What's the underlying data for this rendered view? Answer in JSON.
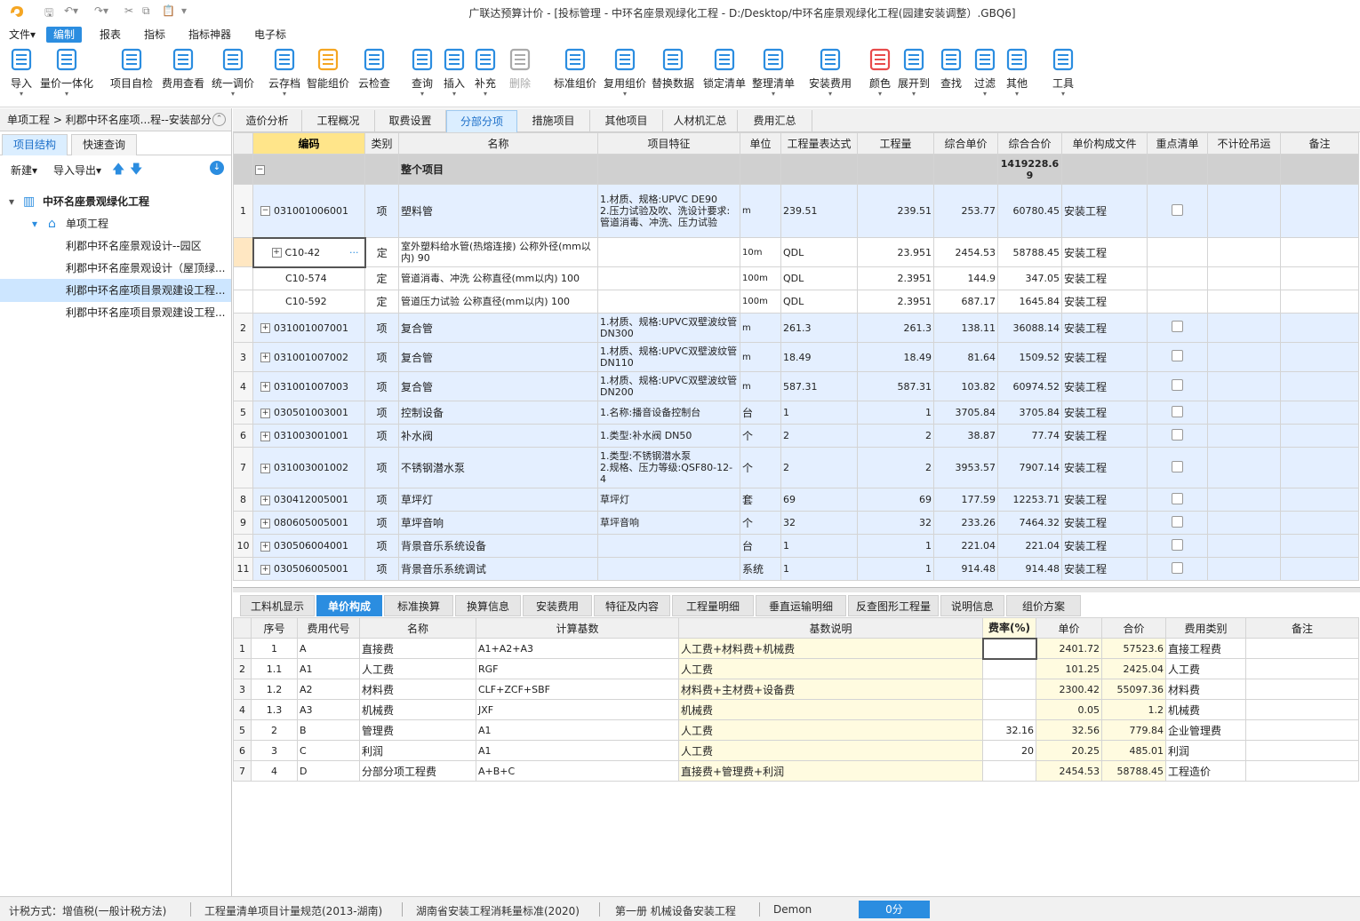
{
  "window": {
    "title": "广联达预算计价 - [投标管理 - 中环名座景观绿化工程 - D:/Desktop/中环名座景观绿化工程(园建安装调整）.GBQ6]"
  },
  "menu": [
    "文件▾",
    "编制",
    "报表",
    "指标",
    "指标神器",
    "电子标"
  ],
  "ribbon": [
    {
      "label": "导入",
      "icon": "import-icon",
      "color": "#2b8de0",
      "drop": "▾"
    },
    {
      "label": "量价一体化",
      "icon": "quantity-price-icon",
      "color": "#2b8de0",
      "drop": "▾"
    },
    {
      "label": "项目自检",
      "icon": "self-check-icon",
      "color": "#2b8de0",
      "drop": ""
    },
    {
      "label": "费用查看",
      "icon": "fee-view-icon",
      "color": "#2b8de0",
      "drop": ""
    },
    {
      "label": "统一调价",
      "icon": "unify-price-icon",
      "color": "#2b8de0",
      "drop": "▾"
    },
    {
      "label": "云存档",
      "icon": "cloud-archive-icon",
      "color": "#2b8de0",
      "drop": "▾"
    },
    {
      "label": "智能组价",
      "icon": "smart-price-icon",
      "color": "#f5a623",
      "drop": ""
    },
    {
      "label": "云检查",
      "icon": "cloud-check-icon",
      "color": "#2b8de0",
      "drop": ""
    },
    {
      "label": "查询",
      "icon": "query-icon",
      "color": "#2b8de0",
      "drop": "▾"
    },
    {
      "label": "插入",
      "icon": "insert-icon",
      "color": "#2b8de0",
      "drop": "▾"
    },
    {
      "label": "补充",
      "icon": "supplement-icon",
      "color": "#2b8de0",
      "drop": "▾"
    },
    {
      "label": "删除",
      "icon": "delete-icon",
      "color": "#aaaaaa",
      "drop": ""
    },
    {
      "label": "标准组价",
      "icon": "standard-price-icon",
      "color": "#2b8de0",
      "drop": ""
    },
    {
      "label": "复用组价",
      "icon": "reuse-price-icon",
      "color": "#2b8de0",
      "drop": "▾"
    },
    {
      "label": "替换数据",
      "icon": "replace-data-icon",
      "color": "#2b8de0",
      "drop": ""
    },
    {
      "label": "锁定清单",
      "icon": "lock-list-icon",
      "color": "#2b8de0",
      "drop": ""
    },
    {
      "label": "整理清单",
      "icon": "organize-list-icon",
      "color": "#2b8de0",
      "drop": "▾"
    },
    {
      "label": "安装费用",
      "icon": "install-fee-icon",
      "color": "#2b8de0",
      "drop": "▾"
    },
    {
      "label": "颜色",
      "icon": "color-icon",
      "color": "#e84b4b",
      "drop": "▾"
    },
    {
      "label": "展开到",
      "icon": "expand-to-icon",
      "color": "#2b8de0",
      "drop": "▾"
    },
    {
      "label": "查找",
      "icon": "find-icon",
      "color": "#2b8de0",
      "drop": ""
    },
    {
      "label": "过滤",
      "icon": "filter-icon",
      "color": "#2b8de0",
      "drop": "▾"
    },
    {
      "label": "其他",
      "icon": "other-icon",
      "color": "#2b8de0",
      "drop": "▾"
    },
    {
      "label": "工具",
      "icon": "tools-icon",
      "color": "#2b8de0",
      "drop": "▾"
    }
  ],
  "left": {
    "breadcrumb": "单项工程 > 利郡中环名座项...程--安装部分",
    "tabs": [
      "项目结构",
      "快速查询"
    ],
    "tools": {
      "new": "新建▾",
      "import_export": "导入导出▾"
    },
    "tree": [
      {
        "label": "中环名座景观绿化工程",
        "level": 0,
        "bold": true
      },
      {
        "label": "单项工程",
        "level": 1,
        "bold": false
      },
      {
        "label": "利郡中环名座景观设计--园区",
        "level": 2,
        "bold": false
      },
      {
        "label": "利郡中环名座景观设计（屋顶绿...",
        "level": 2,
        "bold": false
      },
      {
        "label": "利郡中环名座项目景观建设工程...",
        "level": 2,
        "bold": false,
        "selected": true
      },
      {
        "label": "利郡中环名座项目景观建设工程...",
        "level": 2,
        "bold": false
      }
    ]
  },
  "tabs_top": [
    "造价分析",
    "工程概况",
    "取费设置",
    "分部分项",
    "措施项目",
    "其他项目",
    "人材机汇总",
    "费用汇总"
  ],
  "grid": {
    "headers": [
      "编码",
      "类别",
      "名称",
      "项目特征",
      "单位",
      "工程量表达式",
      "工程量",
      "综合单价",
      "综合合价",
      "单价构成文件",
      "重点清单",
      "不计砼吊运",
      "备注"
    ],
    "total": {
      "label": "整个项目",
      "amount": "1419228.69"
    },
    "rows": [
      {
        "no": "1",
        "code": "031001006001",
        "type": "项",
        "name": "塑料管",
        "feature": "1.材质、规格:UPVC DE90\n2.压力试验及吹、洗设计要求:管道消毒、冲洗、压力试验",
        "unit": "m",
        "expr": "239.51",
        "qty": "239.51",
        "price": "253.77",
        "total": "60780.45",
        "file": "安装工程",
        "kind": "q",
        "exp": "−",
        "h": 60
      },
      {
        "no": "",
        "code": "C10-42",
        "type": "定",
        "name": "室外塑料给水管(热熔连接) 公称外径(mm以内) 90",
        "feature": "",
        "unit": "10m",
        "expr": "QDL",
        "qty": "23.951",
        "price": "2454.53",
        "total": "58788.45",
        "file": "安装工程",
        "kind": "sub",
        "exp": "+",
        "h": 33
      },
      {
        "no": "",
        "code": "C10-574",
        "type": "定",
        "name": "管道消毒、冲洗 公称直径(mm以内) 100",
        "feature": "",
        "unit": "100m",
        "expr": "QDL",
        "qty": "2.3951",
        "price": "144.9",
        "total": "347.05",
        "file": "安装工程",
        "kind": "sub",
        "exp": "",
        "h": 26
      },
      {
        "no": "",
        "code": "C10-592",
        "type": "定",
        "name": "管道压力试验 公称直径(mm以内) 100",
        "feature": "",
        "unit": "100m",
        "expr": "QDL",
        "qty": "2.3951",
        "price": "687.17",
        "total": "1645.84",
        "file": "安装工程",
        "kind": "sub",
        "exp": "",
        "h": 26
      },
      {
        "no": "2",
        "code": "031001007001",
        "type": "项",
        "name": "复合管",
        "feature": "1.材质、规格:UPVC双壁波纹管 DN300",
        "unit": "m",
        "expr": "261.3",
        "qty": "261.3",
        "price": "138.11",
        "total": "36088.14",
        "file": "安装工程",
        "kind": "q",
        "exp": "+",
        "h": 33
      },
      {
        "no": "3",
        "code": "031001007002",
        "type": "项",
        "name": "复合管",
        "feature": "1.材质、规格:UPVC双壁波纹管 DN110",
        "unit": "m",
        "expr": "18.49",
        "qty": "18.49",
        "price": "81.64",
        "total": "1509.52",
        "file": "安装工程",
        "kind": "q",
        "exp": "+",
        "h": 33
      },
      {
        "no": "4",
        "code": "031001007003",
        "type": "项",
        "name": "复合管",
        "feature": "1.材质、规格:UPVC双壁波纹管 DN200",
        "unit": "m",
        "expr": "587.31",
        "qty": "587.31",
        "price": "103.82",
        "total": "60974.52",
        "file": "安装工程",
        "kind": "q",
        "exp": "+",
        "h": 33
      },
      {
        "no": "5",
        "code": "030501003001",
        "type": "项",
        "name": "控制设备",
        "feature": "1.名称:播音设备控制台",
        "unit": "台",
        "expr": "1",
        "qty": "1",
        "price": "3705.84",
        "total": "3705.84",
        "file": "安装工程",
        "kind": "q",
        "exp": "+",
        "h": 26
      },
      {
        "no": "6",
        "code": "031003001001",
        "type": "项",
        "name": "补水阀",
        "feature": "1.类型:补水阀 DN50",
        "unit": "个",
        "expr": "2",
        "qty": "2",
        "price": "38.87",
        "total": "77.74",
        "file": "安装工程",
        "kind": "q",
        "exp": "+",
        "h": 26
      },
      {
        "no": "7",
        "code": "031003001002",
        "type": "项",
        "name": "不锈钢潜水泵",
        "feature": "1.类型:不锈钢潜水泵\n2.规格、压力等级:QSF80-12-4",
        "unit": "个",
        "expr": "2",
        "qty": "2",
        "price": "3953.57",
        "total": "7907.14",
        "file": "安装工程",
        "kind": "q",
        "exp": "+",
        "h": 46
      },
      {
        "no": "8",
        "code": "030412005001",
        "type": "项",
        "name": "草坪灯",
        "feature": "草坪灯",
        "unit": "套",
        "expr": "69",
        "qty": "69",
        "price": "177.59",
        "total": "12253.71",
        "file": "安装工程",
        "kind": "q",
        "exp": "+",
        "h": 26
      },
      {
        "no": "9",
        "code": "080605005001",
        "type": "项",
        "name": "草坪音响",
        "feature": "草坪音响",
        "unit": "个",
        "expr": "32",
        "qty": "32",
        "price": "233.26",
        "total": "7464.32",
        "file": "安装工程",
        "kind": "q",
        "exp": "+",
        "h": 26
      },
      {
        "no": "10",
        "code": "030506004001",
        "type": "项",
        "name": "背景音乐系统设备",
        "feature": "",
        "unit": "台",
        "expr": "1",
        "qty": "1",
        "price": "221.04",
        "total": "221.04",
        "file": "安装工程",
        "kind": "q",
        "exp": "+",
        "h": 26
      },
      {
        "no": "11",
        "code": "030506005001",
        "type": "项",
        "name": "背景音乐系统调试",
        "feature": "",
        "unit": "系统",
        "expr": "1",
        "qty": "1",
        "price": "914.48",
        "total": "914.48",
        "file": "安装工程",
        "kind": "q",
        "exp": "+",
        "h": 26
      }
    ]
  },
  "tabs_bottom": [
    "工料机显示",
    "单价构成",
    "标准换算",
    "换算信息",
    "安装费用",
    "特征及内容",
    "工程量明细",
    "垂直运输明细",
    "反查图形工程量",
    "说明信息",
    "组价方案"
  ],
  "cost": {
    "headers": [
      "序号",
      "费用代号",
      "名称",
      "计算基数",
      "基数说明",
      "费率(%)",
      "单价",
      "合价",
      "费用类别",
      "备注"
    ],
    "rows": [
      {
        "no": "1",
        "seq": "1",
        "code": "A",
        "name": "直接费",
        "base": "A1+A2+A3",
        "desc": "人工费+材料费+机械费",
        "rate": "",
        "price": "2401.72",
        "total": "57523.6",
        "cat": "直接工程费"
      },
      {
        "no": "2",
        "seq": "1.1",
        "code": "A1",
        "name": "人工费",
        "base": "RGF",
        "desc": "人工费",
        "rate": "",
        "price": "101.25",
        "total": "2425.04",
        "cat": "人工费"
      },
      {
        "no": "3",
        "seq": "1.2",
        "code": "A2",
        "name": "材料费",
        "base": "CLF+ZCF+SBF",
        "desc": "材料费+主材费+设备费",
        "rate": "",
        "price": "2300.42",
        "total": "55097.36",
        "cat": "材料费"
      },
      {
        "no": "4",
        "seq": "1.3",
        "code": "A3",
        "name": "机械费",
        "base": "JXF",
        "desc": "机械费",
        "rate": "",
        "price": "0.05",
        "total": "1.2",
        "cat": "机械费"
      },
      {
        "no": "5",
        "seq": "2",
        "code": "B",
        "name": "管理费",
        "base": "A1",
        "desc": "人工费",
        "rate": "32.16",
        "price": "32.56",
        "total": "779.84",
        "cat": "企业管理费"
      },
      {
        "no": "6",
        "seq": "3",
        "code": "C",
        "name": "利润",
        "base": "A1",
        "desc": "人工费",
        "rate": "20",
        "price": "20.25",
        "total": "485.01",
        "cat": "利润"
      },
      {
        "no": "7",
        "seq": "4",
        "code": "D",
        "name": "分部分项工程费",
        "base": "A+B+C",
        "desc": "直接费+管理费+利润",
        "rate": "",
        "price": "2454.53",
        "total": "58788.45",
        "cat": "工程造价"
      }
    ]
  },
  "status": {
    "tax": "计税方式：增值税(一般计税方法)",
    "spec": "工程量清单项目计量规范(2013-湖南)",
    "std": "湖南省安装工程消耗量标准(2020)",
    "book": "第一册 机械设备安装工程",
    "user": "Demon",
    "score": "0分"
  }
}
